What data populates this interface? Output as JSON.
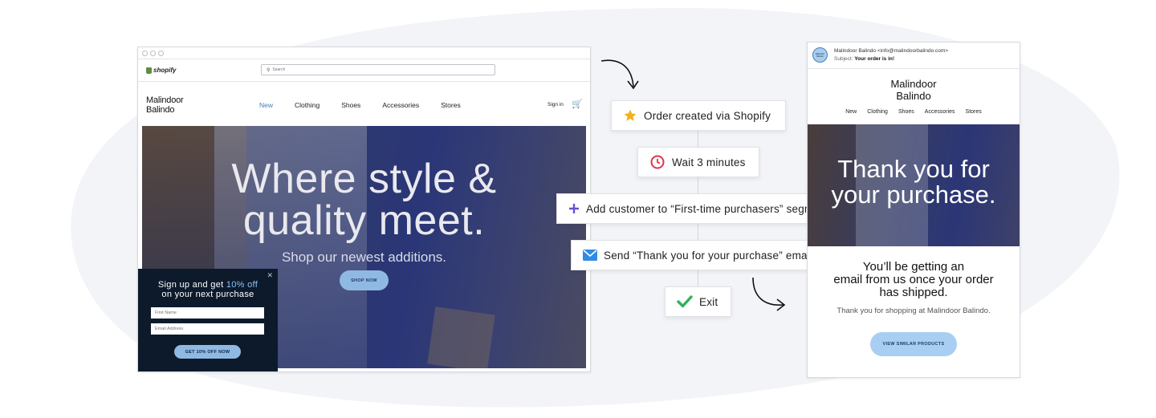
{
  "storefront": {
    "platform_name": "shopify",
    "search_placeholder": "Search",
    "brand_line1": "Malindoor",
    "brand_line2": "Balindo",
    "nav": [
      "New",
      "Clothing",
      "Shoes",
      "Accessories",
      "Stores"
    ],
    "active_nav": "New",
    "sign_in": "Sign in",
    "cart_icon": "cart-icon",
    "hero": {
      "headline_line1": "Where style &",
      "headline_line2": "quality meet.",
      "subheadline": "Shop our newest additions.",
      "cta": "SHOP NOW"
    },
    "popup": {
      "text_before": "Sign up and get ",
      "highlight": "10% off",
      "line2": "on your next purchase",
      "first_name_placeholder": "First Name",
      "email_placeholder": "Email Address",
      "cta": "GET 10% OFF NOW",
      "close_icon": "close-icon"
    }
  },
  "flow": {
    "steps": [
      {
        "label": "Order created via Shopify",
        "icon": "star-icon"
      },
      {
        "label": "Wait 3 minutes",
        "icon": "clock-icon"
      },
      {
        "label": "Add customer to “First-time purchasers” segment",
        "icon": "plus-icon"
      },
      {
        "label": "Send “Thank you for your purchase” email",
        "icon": "envelope-icon"
      },
      {
        "label": "Exit",
        "icon": "check-icon"
      }
    ]
  },
  "email": {
    "avatar_text": "Malindoor Balindo",
    "from": "Malindoor Balindo <info@malindoorbalindo.com>",
    "subject_label": "Subject:",
    "subject": "Your order is in!",
    "brand_line1": "Malindoor",
    "brand_line2": "Balindo",
    "nav": [
      "New",
      "Clothing",
      "Shoes",
      "Accessories",
      "Stores"
    ],
    "hero_line1": "Thank you for",
    "hero_line2": "your purchase.",
    "message_line1": "You’ll be getting an",
    "message_line2": "email from us once your order",
    "message_line3": "has shipped.",
    "thanks": "Thank you for shopping at Malindoor Balindo.",
    "cta": "VIEW SIMILAR PRODUCTS"
  },
  "colors": {
    "accent_blue": "#8fb9e3",
    "popup_bg": "#0c1a2c",
    "star": "#f2b11d",
    "clock": "#e0344a",
    "plus": "#6b4fd1",
    "envelope": "#2f8be6",
    "check": "#2fb35a"
  }
}
